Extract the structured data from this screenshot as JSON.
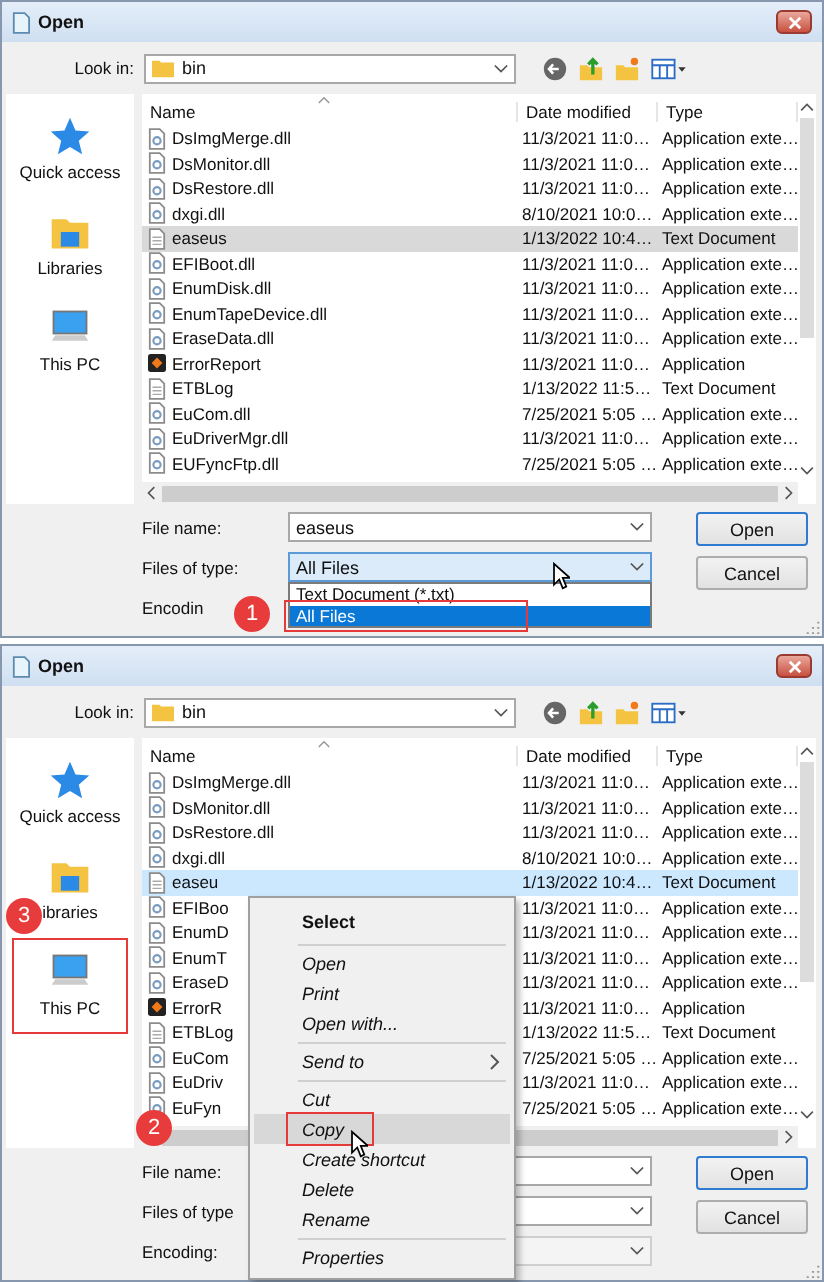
{
  "dialogs": [
    {
      "title": "Open",
      "look_in_label": "Look in:",
      "look_in_value": "bin",
      "list_focused": false,
      "sidebar": [
        {
          "label": "Quick access",
          "kind": "quick-access"
        },
        {
          "label": "Libraries",
          "kind": "libraries"
        },
        {
          "label": "This PC",
          "kind": "pc"
        }
      ],
      "columns": [
        "Name",
        "Date modified",
        "Type"
      ],
      "files": [
        {
          "name": "DsImgMerge.dll",
          "date": "11/3/2021 11:0…",
          "type": "Application exte…",
          "kind": "dll",
          "selected": false
        },
        {
          "name": "DsMonitor.dll",
          "date": "11/3/2021 11:0…",
          "type": "Application exte…",
          "kind": "dll",
          "selected": false
        },
        {
          "name": "DsRestore.dll",
          "date": "11/3/2021 11:0…",
          "type": "Application exte…",
          "kind": "dll",
          "selected": false
        },
        {
          "name": "dxgi.dll",
          "date": "8/10/2021 10:0…",
          "type": "Application exte…",
          "kind": "dll",
          "selected": false
        },
        {
          "name": "easeus",
          "date": "1/13/2022 10:4…",
          "type": "Text Document",
          "kind": "txt",
          "selected": true
        },
        {
          "name": "EFIBoot.dll",
          "date": "11/3/2021 11:0…",
          "type": "Application exte…",
          "kind": "dll",
          "selected": false
        },
        {
          "name": "EnumDisk.dll",
          "date": "11/3/2021 11:0…",
          "type": "Application exte…",
          "kind": "dll",
          "selected": false
        },
        {
          "name": "EnumTapeDevice.dll",
          "date": "11/3/2021 11:0…",
          "type": "Application exte…",
          "kind": "dll",
          "selected": false
        },
        {
          "name": "EraseData.dll",
          "date": "11/3/2021 11:0…",
          "type": "Application exte…",
          "kind": "dll",
          "selected": false
        },
        {
          "name": "ErrorReport",
          "date": "11/3/2021 11:0…",
          "type": "Application",
          "kind": "app",
          "selected": false
        },
        {
          "name": "ETBLog",
          "date": "1/13/2022 11:5…",
          "type": "Text Document",
          "kind": "txt",
          "selected": false
        },
        {
          "name": "EuCom.dll",
          "date": "7/25/2021 5:05 …",
          "type": "Application exte…",
          "kind": "dll",
          "selected": false
        },
        {
          "name": "EuDriverMgr.dll",
          "date": "11/3/2021 11:0…",
          "type": "Application exte…",
          "kind": "dll",
          "selected": false
        },
        {
          "name": "EUFyncFtp.dll",
          "date": "7/25/2021 5:05 …",
          "type": "Application exte…",
          "kind": "dll",
          "selected": false
        }
      ],
      "file_name_label": "File name:",
      "file_name_value": "easeus",
      "file_type_label": "Files of type:",
      "file_type_value": "All Files",
      "type_options": [
        {
          "label": "Text Document (*.txt)",
          "selected": false
        },
        {
          "label": "All Files",
          "selected": true,
          "callout": "1"
        }
      ],
      "encoding_label": "Encodin",
      "buttons": [
        {
          "label": "Open",
          "default": true
        },
        {
          "label": "Cancel",
          "default": false
        }
      ]
    },
    {
      "title": "Open",
      "look_in_label": "Look in:",
      "look_in_value": "bin",
      "list_focused": true,
      "sidebar": [
        {
          "label": "Quick access",
          "kind": "quick-access"
        },
        {
          "label": "ibraries",
          "kind": "libraries"
        },
        {
          "label": "This PC",
          "kind": "pc",
          "callout": "3"
        }
      ],
      "columns": [
        "Name",
        "Date modified",
        "Type"
      ],
      "files": [
        {
          "name": "DsImgMerge.dll",
          "date": "11/3/2021 11:0…",
          "type": "Application exte…",
          "kind": "dll",
          "selected": false
        },
        {
          "name": "DsMonitor.dll",
          "date": "11/3/2021 11:0…",
          "type": "Application exte…",
          "kind": "dll",
          "selected": false
        },
        {
          "name": "DsRestore.dll",
          "date": "11/3/2021 11:0…",
          "type": "Application exte…",
          "kind": "dll",
          "selected": false
        },
        {
          "name": "dxgi.dll",
          "date": "8/10/2021 10:0…",
          "type": "Application exte…",
          "kind": "dll",
          "selected": false
        },
        {
          "name": "easeu",
          "date": "1/13/2022 10:4…",
          "type": "Text Document",
          "kind": "txt",
          "selected": true
        },
        {
          "name": "EFIBoo",
          "date": "11/3/2021 11:0…",
          "type": "Application exte…",
          "kind": "dll",
          "selected": false
        },
        {
          "name": "EnumD",
          "date": "11/3/2021 11:0…",
          "type": "Application exte…",
          "kind": "dll",
          "selected": false
        },
        {
          "name": "EnumT",
          "date": "11/3/2021 11:0…",
          "type": "Application exte…",
          "kind": "dll",
          "selected": false
        },
        {
          "name": "EraseD",
          "date": "11/3/2021 11:0…",
          "type": "Application exte…",
          "kind": "dll",
          "selected": false
        },
        {
          "name": "ErrorR",
          "date": "11/3/2021 11:0…",
          "type": "Application",
          "kind": "app",
          "selected": false
        },
        {
          "name": "ETBLog",
          "date": "1/13/2022 11:5…",
          "type": "Text Document",
          "kind": "txt",
          "selected": false
        },
        {
          "name": "EuCom",
          "date": "7/25/2021 5:05 …",
          "type": "Application exte…",
          "kind": "dll",
          "selected": false
        },
        {
          "name": "EuDriv",
          "date": "11/3/2021 11:0…",
          "type": "Application exte…",
          "kind": "dll",
          "selected": false
        },
        {
          "name": "EuFyn",
          "date": "7/25/2021 5:05 …",
          "type": "Application exte…",
          "kind": "dll",
          "selected": false
        }
      ],
      "file_name_label": "File name:",
      "file_type_label": "Files of type",
      "encoding_label": "Encoding:",
      "context_menu": [
        {
          "label": "Select",
          "kind": "default",
          "hovered": false
        },
        {
          "kind": "separator"
        },
        {
          "label": "Open",
          "kind": "item",
          "hovered": false
        },
        {
          "label": "Print",
          "kind": "item",
          "hovered": false
        },
        {
          "label": "Open with...",
          "kind": "item",
          "hovered": false
        },
        {
          "kind": "separator"
        },
        {
          "label": "Send to",
          "kind": "submenu",
          "hovered": false
        },
        {
          "kind": "separator"
        },
        {
          "label": "Cut",
          "kind": "item",
          "hovered": false
        },
        {
          "label": "Copy",
          "kind": "item",
          "hovered": true,
          "callout": "2"
        },
        {
          "label": "Create shortcut",
          "kind": "item",
          "hovered": false
        },
        {
          "label": "Delete",
          "kind": "item",
          "hovered": false
        },
        {
          "label": "Rename",
          "kind": "item",
          "hovered": false
        },
        {
          "kind": "separator"
        },
        {
          "label": "Properties",
          "kind": "item",
          "hovered": false
        }
      ],
      "buttons": [
        {
          "label": "Open",
          "default": true
        },
        {
          "label": "Cancel",
          "default": false
        }
      ]
    }
  ]
}
